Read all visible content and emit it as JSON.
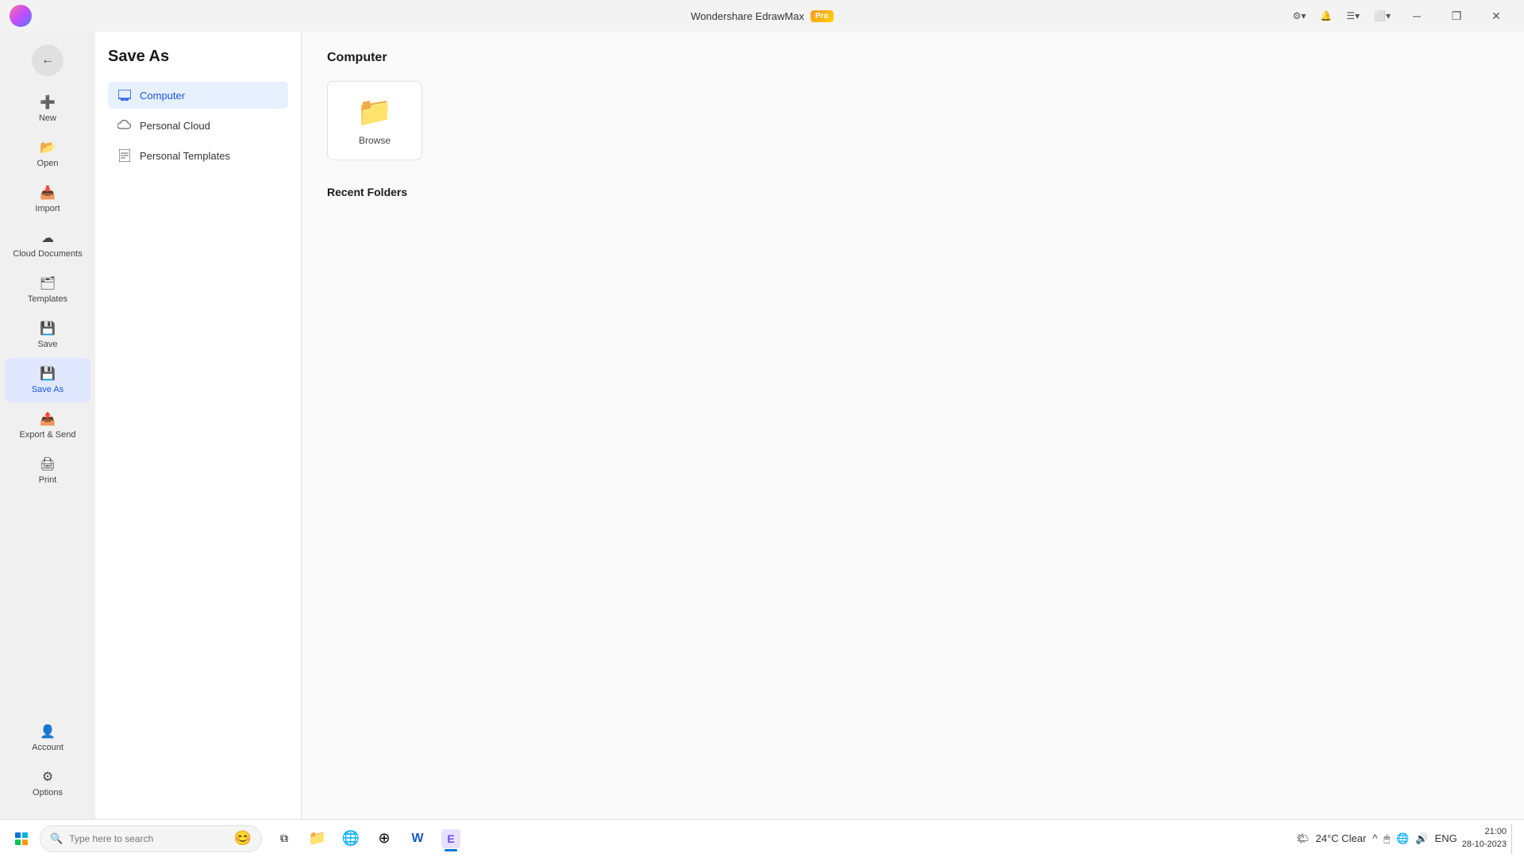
{
  "app": {
    "title": "Wondershare EdrawMax",
    "pro_label": "Pro"
  },
  "titlebar": {
    "minimize": "─",
    "restore": "❐",
    "close": "✕",
    "toolbar_icons": [
      "⚙",
      "🔔",
      "☰",
      "⬜"
    ]
  },
  "left_nav": {
    "back_label": "←",
    "items": [
      {
        "id": "new",
        "label": "New",
        "icon": "➕"
      },
      {
        "id": "open",
        "label": "Open",
        "icon": "📂"
      },
      {
        "id": "import",
        "label": "Import",
        "icon": "📥"
      },
      {
        "id": "cloud-documents",
        "label": "Cloud Documents",
        "icon": "☁"
      },
      {
        "id": "templates",
        "label": "Templates",
        "icon": "🗂"
      },
      {
        "id": "save",
        "label": "Save",
        "icon": "💾"
      },
      {
        "id": "save-as",
        "label": "Save As",
        "icon": "💾",
        "active": true
      },
      {
        "id": "export-send",
        "label": "Export & Send",
        "icon": "📤"
      },
      {
        "id": "print",
        "label": "Print",
        "icon": "🖨"
      }
    ],
    "bottom_items": [
      {
        "id": "account",
        "label": "Account",
        "icon": "👤"
      },
      {
        "id": "options",
        "label": "Options",
        "icon": "⚙"
      }
    ]
  },
  "panel": {
    "title": "Save As",
    "locations": [
      {
        "id": "computer",
        "label": "Computer",
        "active": true
      },
      {
        "id": "personal-cloud",
        "label": "Personal Cloud",
        "active": false
      },
      {
        "id": "personal-templates",
        "label": "Personal Templates",
        "active": false
      }
    ]
  },
  "main": {
    "section_title": "Computer",
    "browse_label": "Browse",
    "recent_folders_title": "Recent Folders"
  },
  "taskbar": {
    "search_placeholder": "Type here to search",
    "apps": [
      {
        "id": "task-view",
        "icon": "⊞"
      },
      {
        "id": "file-explorer",
        "icon": "📁"
      },
      {
        "id": "edge",
        "icon": "🌐"
      },
      {
        "id": "chrome",
        "icon": "⊕"
      },
      {
        "id": "word",
        "icon": "W"
      },
      {
        "id": "edrawmax",
        "icon": "E",
        "active": true
      }
    ],
    "weather": "24°C Clear",
    "language": "ENG",
    "time": "21:00",
    "date": "28-10-2023"
  }
}
